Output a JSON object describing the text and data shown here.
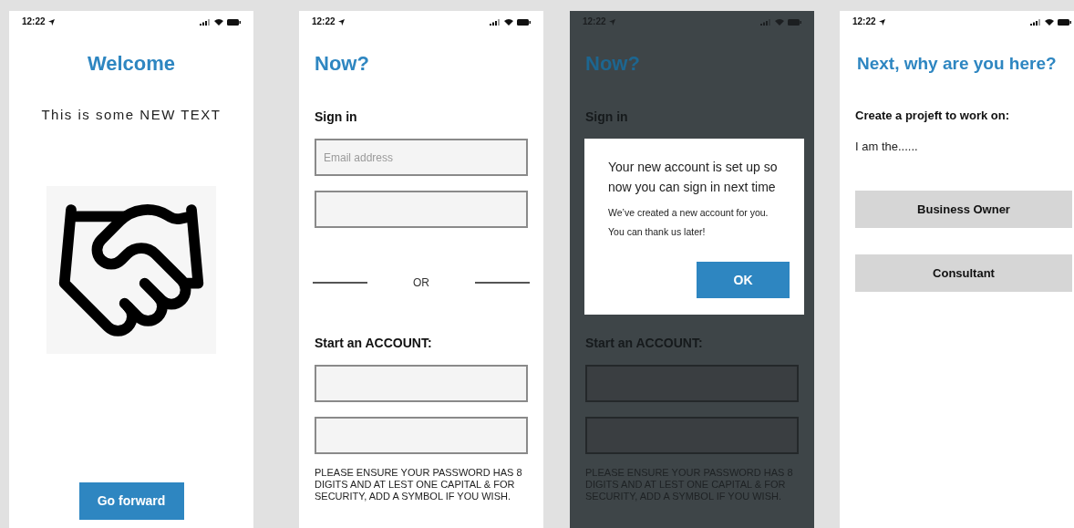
{
  "screens": [
    {
      "kind": "welcome",
      "status_time": "12:22",
      "title": "Welcome",
      "subtitle": "This is some NEW TEXT",
      "button": "Go forward"
    },
    {
      "kind": "signup",
      "dimmed": false,
      "status_time": "12:22",
      "title": "Now?",
      "sign_in_label": "Sign in",
      "email_placeholder": "Email address",
      "or_label": "OR",
      "account_label": "Start an ACCOUNT:",
      "note": "PLEASE ENSURE YOUR PASSWORD HAS 8 DIGITS AND AT LEST ONE CAPITAL & FOR SECURITY, ADD A SYMBOL IF YOU WISH."
    },
    {
      "kind": "signup",
      "dimmed": true,
      "status_time": "12:22",
      "title": "Now?",
      "sign_in_label": "Sign in",
      "account_label": "Start an ACCOUNT:",
      "note": "PLEASE ENSURE YOUR PASSWORD HAS 8 DIGITS AND AT LEST ONE CAPITAL & FOR SECURITY, ADD A SYMBOL IF YOU WISH.",
      "dialog": {
        "title": "Your new account is set up so now you can sign in next time",
        "lines": [
          "We’ve created a new account for you.",
          "You can thank us later!"
        ],
        "button": "OK"
      }
    },
    {
      "kind": "choice",
      "status_time": "12:22",
      "title": "Next, why are you here?",
      "prompt": "Create a projeft to work on:",
      "lead": "I am the......",
      "options": [
        "Business Owner",
        "Consultant"
      ]
    }
  ]
}
